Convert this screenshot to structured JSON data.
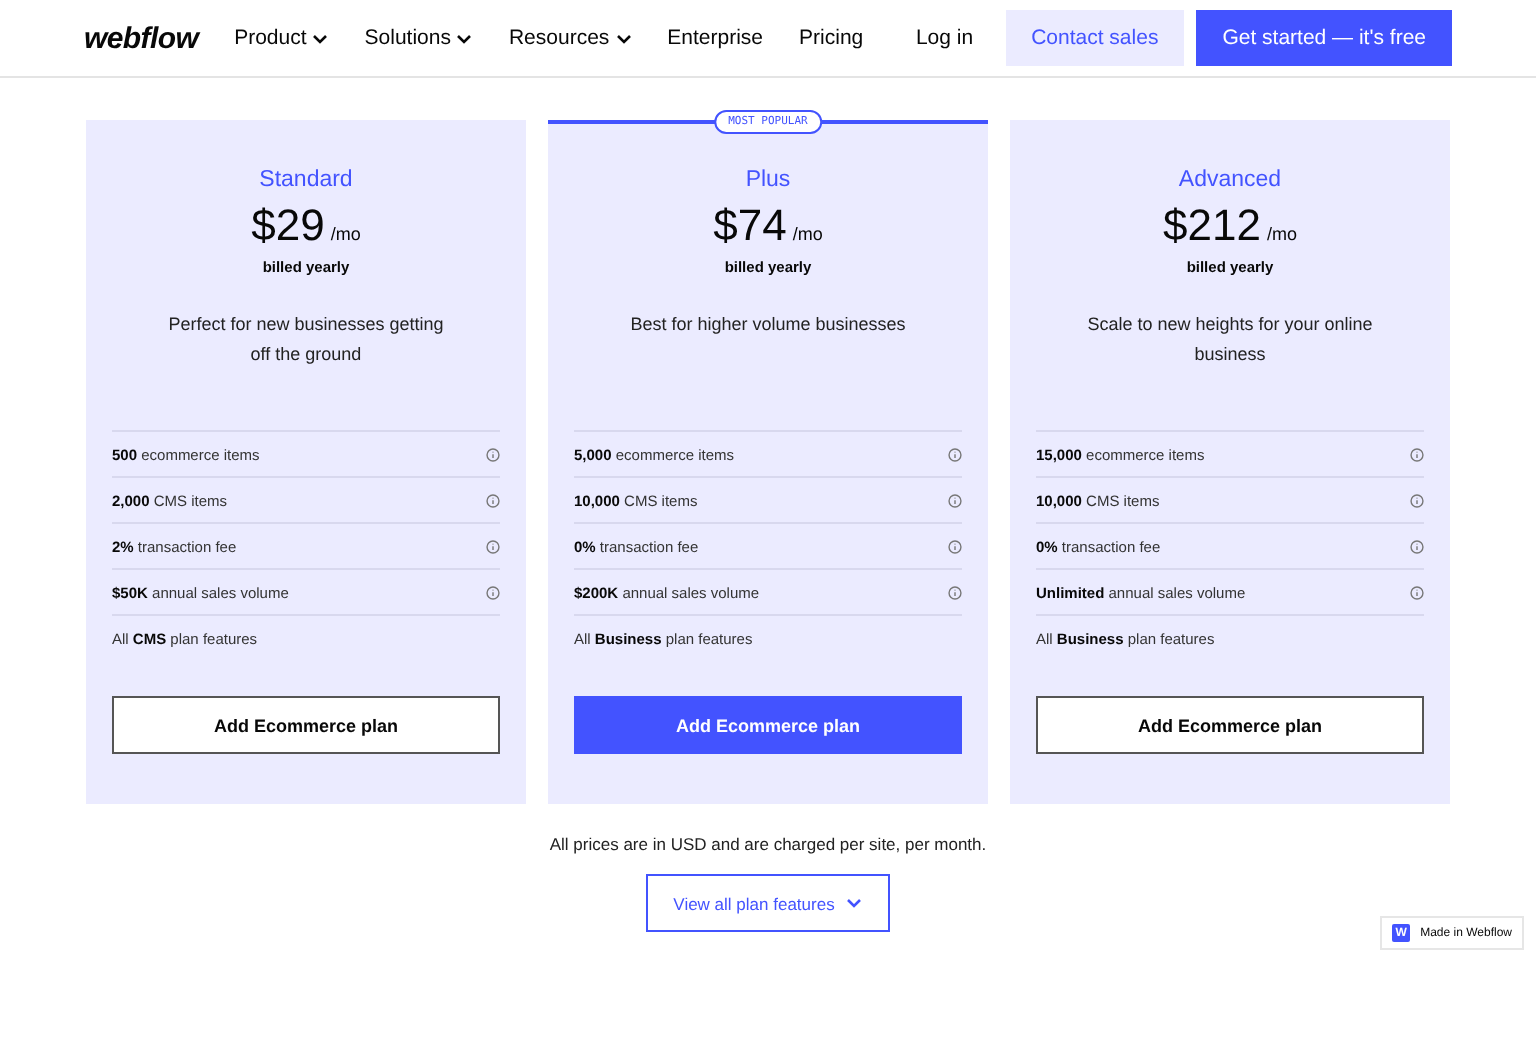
{
  "nav": {
    "logo": "webflow",
    "links": [
      {
        "label": "Product",
        "dropdown": true
      },
      {
        "label": "Solutions",
        "dropdown": true
      },
      {
        "label": "Resources",
        "dropdown": true
      },
      {
        "label": "Enterprise",
        "dropdown": false
      },
      {
        "label": "Pricing",
        "dropdown": false
      }
    ],
    "login": "Log in",
    "contact": "Contact sales",
    "cta": "Get started — it's free"
  },
  "plans": [
    {
      "name": "Standard",
      "price": "$29",
      "period": "/mo",
      "billing": "billed yearly",
      "description": "Perfect for new businesses getting off the ground",
      "popular": false,
      "features": [
        {
          "text": "**500** ecommerce items",
          "info": true
        },
        {
          "text": "**2,000** CMS items",
          "info": true
        },
        {
          "text": "**2%** transaction fee",
          "info": true
        },
        {
          "text": "**$50K** annual sales volume",
          "info": true
        },
        {
          "text": "All **CMS** plan features",
          "info": false
        }
      ],
      "button": {
        "label": "Add Ecommerce plan",
        "primary": false
      }
    },
    {
      "name": "Plus",
      "price": "$74",
      "period": "/mo",
      "billing": "billed yearly",
      "description": "Best for higher volume businesses",
      "popular": true,
      "badge": "MOST POPULAR",
      "features": [
        {
          "text": "**5,000** ecommerce items",
          "info": true
        },
        {
          "text": "**10,000** CMS items",
          "info": true
        },
        {
          "text": "**0%** transaction fee",
          "info": true
        },
        {
          "text": "**$200K** annual sales volume",
          "info": true
        },
        {
          "text": "All **Business** plan features",
          "info": false
        }
      ],
      "button": {
        "label": "Add Ecommerce plan",
        "primary": true
      }
    },
    {
      "name": "Advanced",
      "price": "$212",
      "period": "/mo",
      "billing": "billed yearly",
      "description": "Scale to new heights for your online business",
      "popular": false,
      "features": [
        {
          "text": "**15,000** ecommerce items",
          "info": true
        },
        {
          "text": "**10,000** CMS items",
          "info": true
        },
        {
          "text": "**0%** transaction fee",
          "info": true
        },
        {
          "text": "**Unlimited** annual sales volume",
          "info": true
        },
        {
          "text": "All **Business** plan features",
          "info": false
        }
      ],
      "button": {
        "label": "Add Ecommerce plan",
        "primary": false
      }
    }
  ],
  "note": "All prices are in USD and are charged per site, per month.",
  "view_all": "View all plan features",
  "made_in_badge": {
    "icon": "W",
    "label": "Made in Webflow"
  }
}
